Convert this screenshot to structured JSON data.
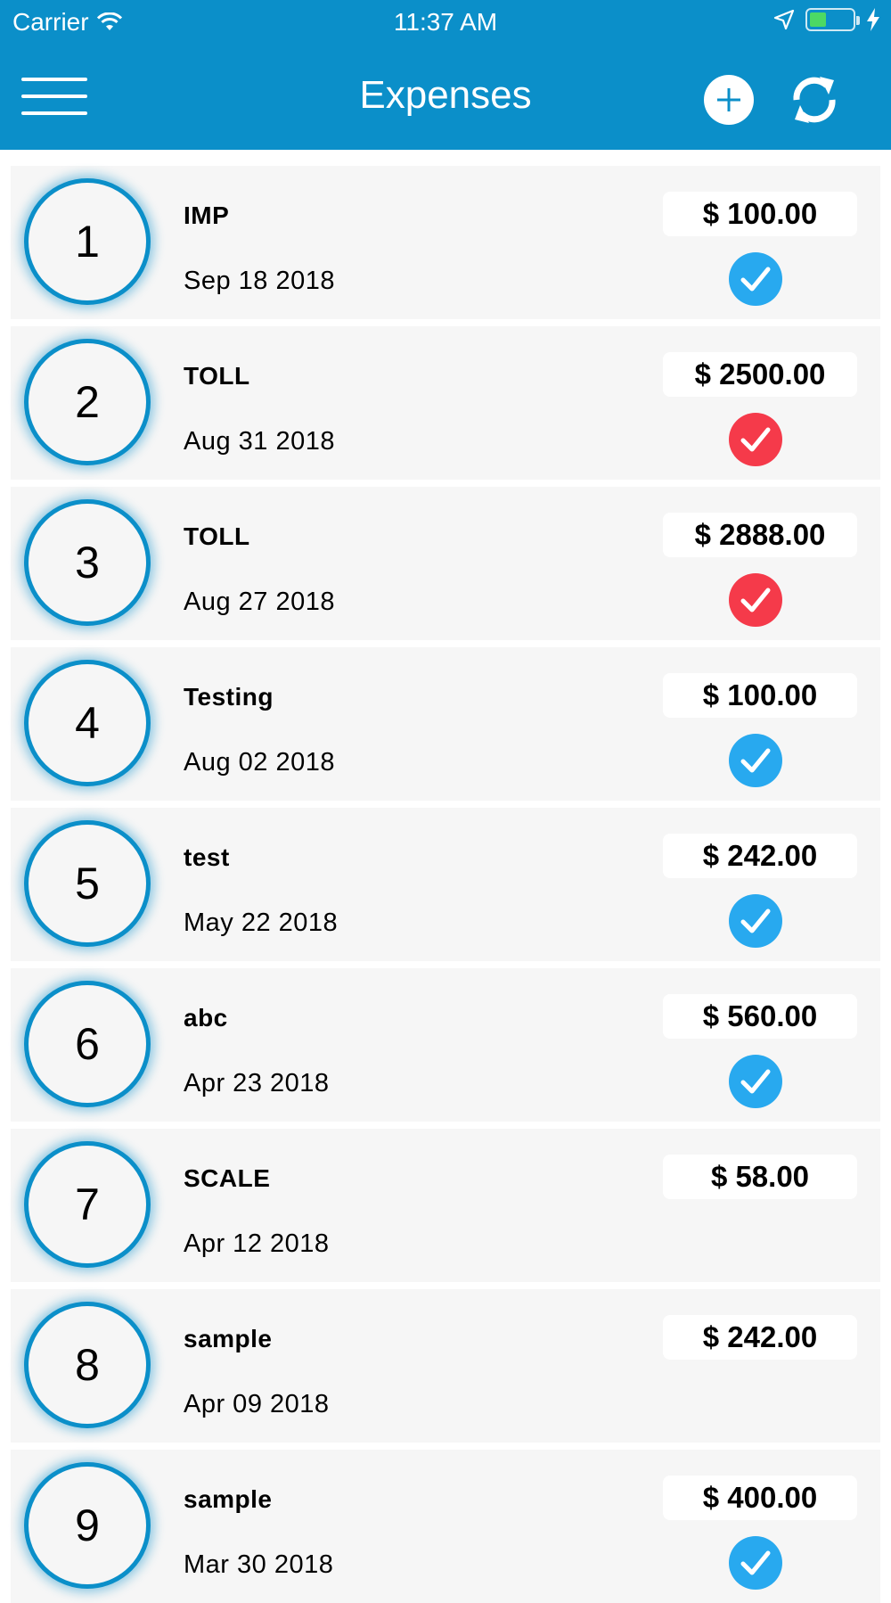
{
  "status_bar": {
    "carrier": "Carrier",
    "time": "11:37 AM",
    "battery_level": 0.4,
    "battery_color": "#4cd964"
  },
  "nav": {
    "title": "Expenses",
    "menu_icon": "hamburger-menu-icon",
    "add_icon": "plus-circle-icon",
    "refresh_icon": "sync-arrows-icon",
    "bar_color": "#0b8fc9"
  },
  "expenses": [
    {
      "index": "1",
      "title": "IMP",
      "date": "Sep 18 2018",
      "amount": "$ 100.00",
      "status": "approved"
    },
    {
      "index": "2",
      "title": "TOLL",
      "date": "Aug 31 2018",
      "amount": "$ 2500.00",
      "status": "rejected"
    },
    {
      "index": "3",
      "title": "TOLL",
      "date": "Aug 27 2018",
      "amount": "$ 2888.00",
      "status": "rejected"
    },
    {
      "index": "4",
      "title": "Testing",
      "date": "Aug 02 2018",
      "amount": "$ 100.00",
      "status": "approved"
    },
    {
      "index": "5",
      "title": "test",
      "date": "May 22 2018",
      "amount": "$ 242.00",
      "status": "approved"
    },
    {
      "index": "6",
      "title": "abc",
      "date": "Apr 23 2018",
      "amount": "$ 560.00",
      "status": "approved"
    },
    {
      "index": "7",
      "title": "SCALE",
      "date": "Apr 12 2018",
      "amount": "$ 58.00",
      "status": "none"
    },
    {
      "index": "8",
      "title": "sample",
      "date": "Apr 09 2018",
      "amount": "$ 242.00",
      "status": "none"
    },
    {
      "index": "9",
      "title": "sample",
      "date": "Mar 30 2018",
      "amount": "$ 400.00",
      "status": "approved"
    }
  ],
  "status_colors": {
    "approved": "#28a9ef",
    "rejected": "#f53a4a"
  }
}
